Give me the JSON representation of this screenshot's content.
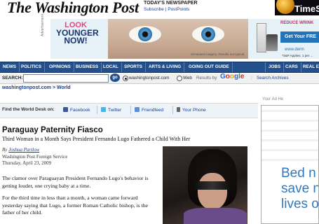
{
  "masthead": {
    "logo": "The Washington Post",
    "todays_newspaper": "TODAY'S NEWSPAPER",
    "subscribe": "Subscribe | PostPoints",
    "corner_ad_text": "TimeS"
  },
  "banner_ad": {
    "label": "Advertisement",
    "line1": "LOOK",
    "line2": "YOUNGER",
    "line3": "NOW!",
    "disclaimer": "Simulated imagery. Results not typical.",
    "reduce_text": "REDUCE WRINK",
    "cta": "Get Your FRE",
    "site": "www.derm",
    "fine_print": "*S&P Applies. 1 per ..."
  },
  "nav": {
    "items": [
      "NEWS",
      "POLITICS",
      "OPINIONS",
      "BUSINESS",
      "LOCAL",
      "SPORTS",
      "ARTS & LIVING",
      "GOING OUT GUIDE",
      "JOBS",
      "CARS",
      "REAL E"
    ]
  },
  "search": {
    "label": "SEARCH:",
    "input_value": "",
    "go": "go",
    "option_site": "washingtonpost.com",
    "option_web": "Web",
    "results_by": "Results by",
    "google": "Google",
    "archives": "Search Archives"
  },
  "breadcrumb": "washingtonpost.com > World",
  "share": {
    "find": "Find the World Desk on:",
    "facebook": "Facebook",
    "twitter": "Twitter",
    "friendfeed": "Friendfeed",
    "phone": "Your Phone"
  },
  "right_ad": {
    "label": "Your Ad He",
    "line1": "Bed n",
    "line2": "save n",
    "line3": "lives o"
  },
  "article": {
    "headline": "Paraguay Paternity Fiasco",
    "subhead": "Third Woman in a Month Says President Fernando Lugo Fathered a Child With Her",
    "by": "By",
    "author": "Joshua Partlow",
    "affiliation": "Washington Post Foreign Service",
    "date": "Thursday, April 23, 2009",
    "p1": "The clamor over Paraguayan President Fernando Lugo's behavior is getting louder, one crying baby at a time.",
    "p2": "For the third time in less than a month, a woman came forward yesterday saying that Lugo, a former Roman Catholic bishop, is the father of her child."
  },
  "colors": {
    "nav_bg": "#23508c",
    "link": "#1a3f8a",
    "ad_pink": "#e0457e",
    "ad_blue": "#2f79c2"
  }
}
